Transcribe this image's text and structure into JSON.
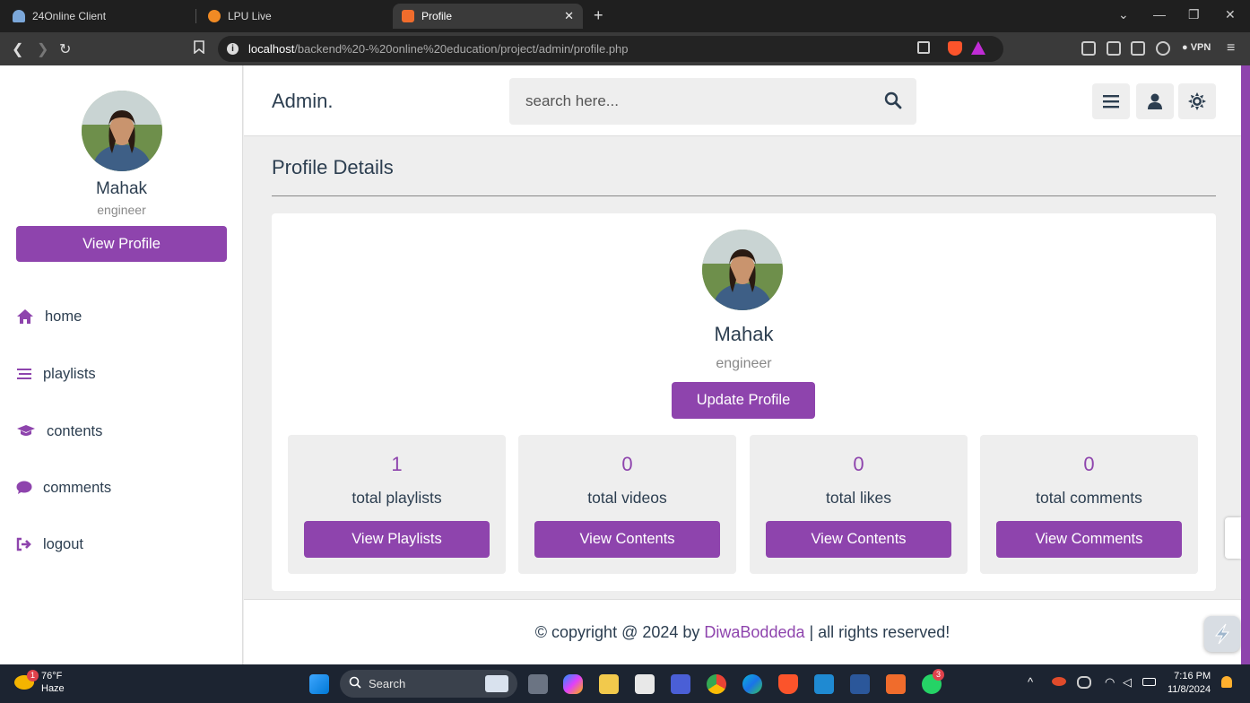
{
  "browser": {
    "tabs": [
      {
        "label": "24Online Client"
      },
      {
        "label": "LPU Live"
      },
      {
        "label": "Profile"
      }
    ],
    "url_host": "localhost",
    "url_path": "/backend%20-%20online%20education/project/admin/profile.php",
    "vpn_label": "VPN"
  },
  "sidebar": {
    "name": "Mahak",
    "role": "engineer",
    "view_profile_label": "View Profile",
    "nav": [
      {
        "label": "home",
        "icon": "home-icon"
      },
      {
        "label": "playlists",
        "icon": "list-icon"
      },
      {
        "label": "contents",
        "icon": "graduation-cap-icon"
      },
      {
        "label": "comments",
        "icon": "comment-icon"
      },
      {
        "label": "logout",
        "icon": "logout-icon"
      }
    ]
  },
  "header": {
    "logo": "Admin.",
    "search_placeholder": "search here..."
  },
  "main": {
    "title": "Profile Details",
    "profile": {
      "name": "Mahak",
      "role": "engineer",
      "update_label": "Update Profile"
    },
    "stats": [
      {
        "value": "1",
        "label": "total playlists",
        "button": "View Playlists"
      },
      {
        "value": "0",
        "label": "total videos",
        "button": "View Contents"
      },
      {
        "value": "0",
        "label": "total likes",
        "button": "View Contents"
      },
      {
        "value": "0",
        "label": "total comments",
        "button": "View Comments"
      }
    ]
  },
  "footer": {
    "prefix": "© copyright @ 2024 by ",
    "author": "DiwaBoddeda",
    "suffix": " | all rights reserved!"
  },
  "taskbar": {
    "temp": "76°F",
    "weather": "Haze",
    "search_label": "Search",
    "time": "7:16 PM",
    "date": "11/8/2024",
    "weather_badge": "1",
    "whatsapp_badge": "3"
  },
  "colors": {
    "accent": "#8e44ad",
    "text": "#2c3e50",
    "background": "#eeeeee"
  }
}
